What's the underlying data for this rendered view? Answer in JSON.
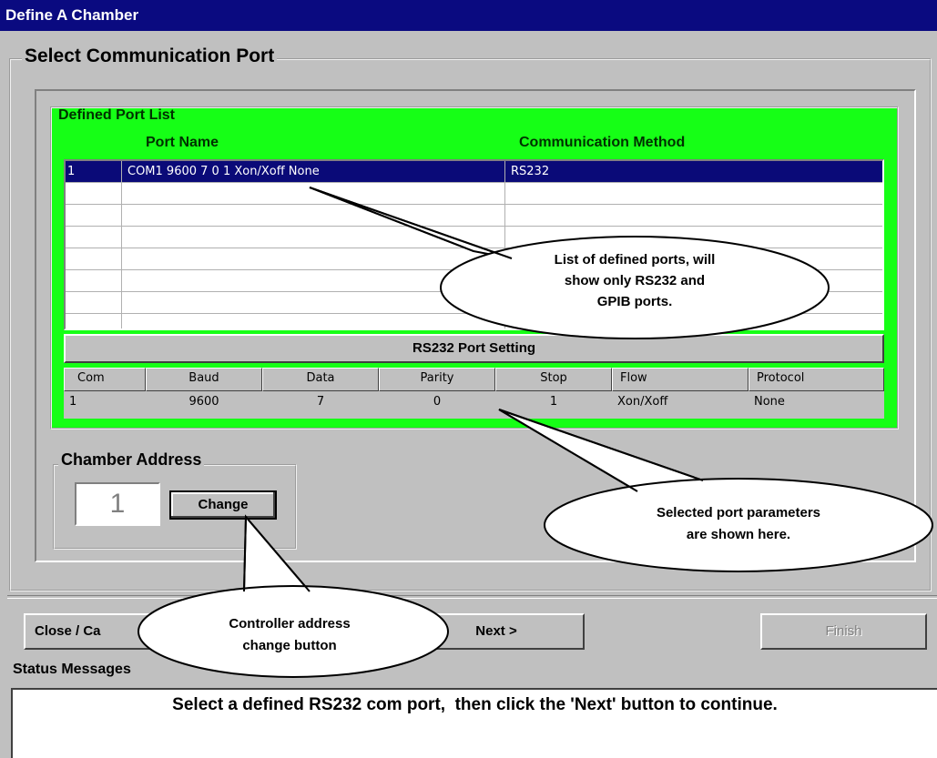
{
  "window": {
    "title": "Define A Chamber"
  },
  "main_group": {
    "legend": "Select Communication Port"
  },
  "port_list": {
    "legend": "Defined Port List",
    "columns": [
      "Port Name",
      "Communication Method"
    ],
    "rows": [
      {
        "index": "1",
        "port_name": "COM1 9600 7 0 1 Xon/Xoff None",
        "method": "RS232",
        "selected": true
      }
    ]
  },
  "rs232_settings": {
    "title": "RS232 Port Setting",
    "columns": [
      "Com",
      "Baud",
      "Data",
      "Parity",
      "Stop",
      "Flow",
      "Protocol"
    ],
    "values": [
      "1",
      "9600",
      "7",
      "0",
      "1",
      "Xon/Xoff",
      "None"
    ]
  },
  "chamber_address": {
    "legend": "Chamber Address",
    "value": "1",
    "change_label": "Change"
  },
  "buttons": {
    "close_cancel": "Close / Ca",
    "next": "Next >",
    "finish": "Finish"
  },
  "status": {
    "label": "Status Messages",
    "message": "Select a defined RS232 com port,  then click the 'Next' button to continue."
  },
  "callouts": {
    "port_list_line1": "List of defined ports, will",
    "port_list_line2": "show only RS232 and",
    "port_list_line3": "GPIB ports.",
    "params_line1": "Selected port parameters",
    "params_line2": "are shown here.",
    "address_line1": "Controller address",
    "address_line2": "change button"
  },
  "colors": {
    "title_bar": "#0a0a80",
    "panel_green": "#16ff16",
    "selection": "#0a0a78",
    "dialog": "#c0c0c0"
  }
}
